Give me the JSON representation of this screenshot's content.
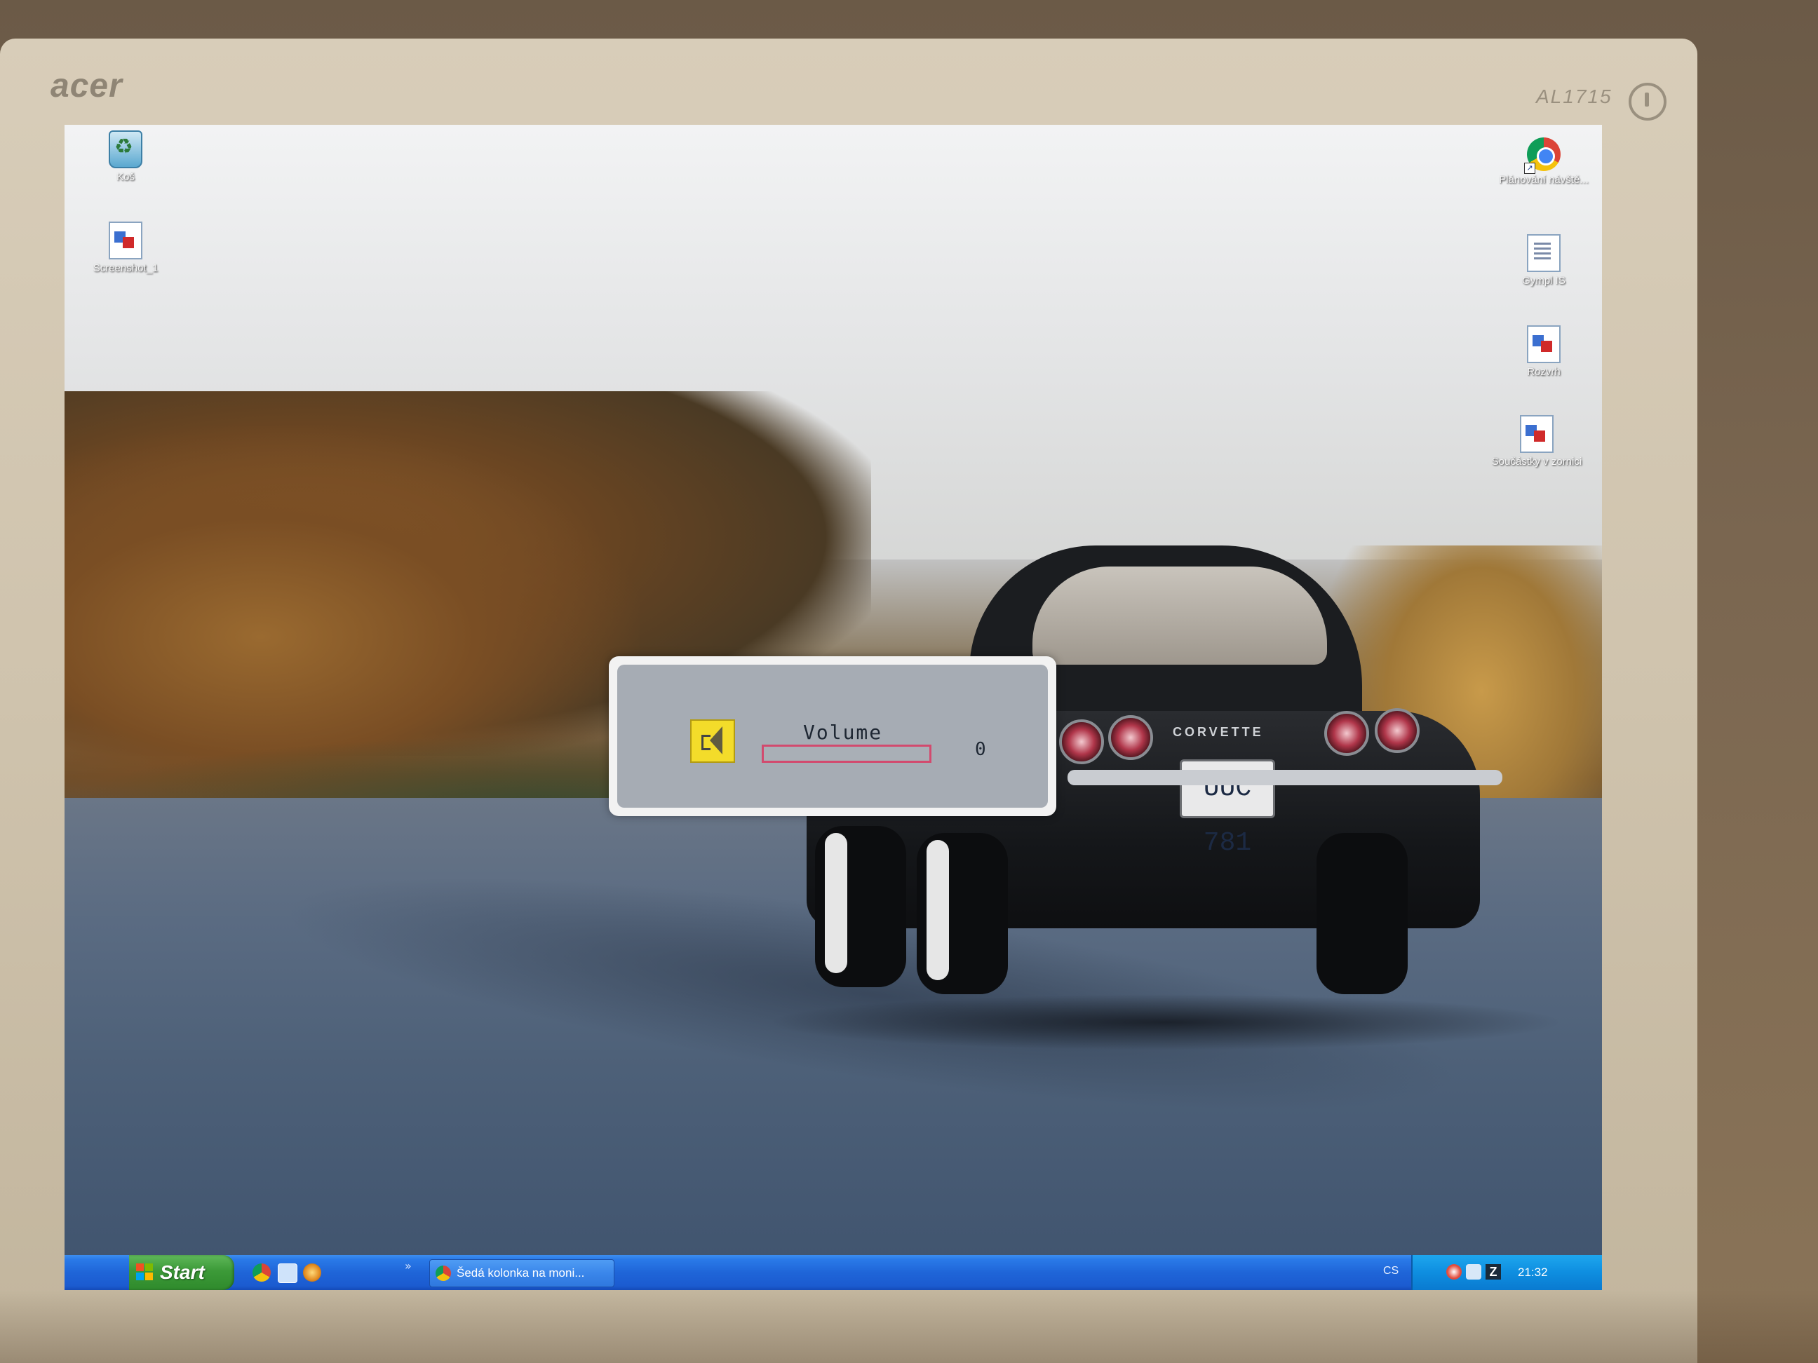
{
  "monitor": {
    "brand": "acer",
    "model": "AL1715"
  },
  "desktop": {
    "left_icons": [
      {
        "label": "Koš",
        "icon": "recycle-bin-icon"
      },
      {
        "label": "Screenshot_1",
        "icon": "image-file-icon"
      }
    ],
    "right_icons": [
      {
        "label": "Plánování návště...",
        "icon": "chrome-shortcut-icon"
      },
      {
        "label": "Gympl IS",
        "icon": "document-icon"
      },
      {
        "label": "Rozvrh",
        "icon": "image-file-icon"
      },
      {
        "label": "Součástky v zornici",
        "icon": "image-file-icon"
      }
    ],
    "wallpaper": {
      "license_plate": "UUC 781",
      "badge": "CORVETTE"
    }
  },
  "osd": {
    "title": "Volume",
    "value": "0",
    "level_fraction": 0,
    "icon": "speaker-icon",
    "accent_color": "#f3dc2a",
    "bar_color": "#d24a6e"
  },
  "taskbar": {
    "start_label": "Start",
    "quick_launch": [
      "chrome-icon",
      "show-desktop-icon",
      "media-player-icon"
    ],
    "more_label": "»",
    "tasks": [
      {
        "title": "Šedá kolonka na moni...",
        "icon": "chrome-icon"
      }
    ],
    "language": "CS",
    "tray_icons": [
      "antivirus-icon",
      "network-icon",
      "zotero-icon"
    ],
    "clock": "21:32"
  }
}
